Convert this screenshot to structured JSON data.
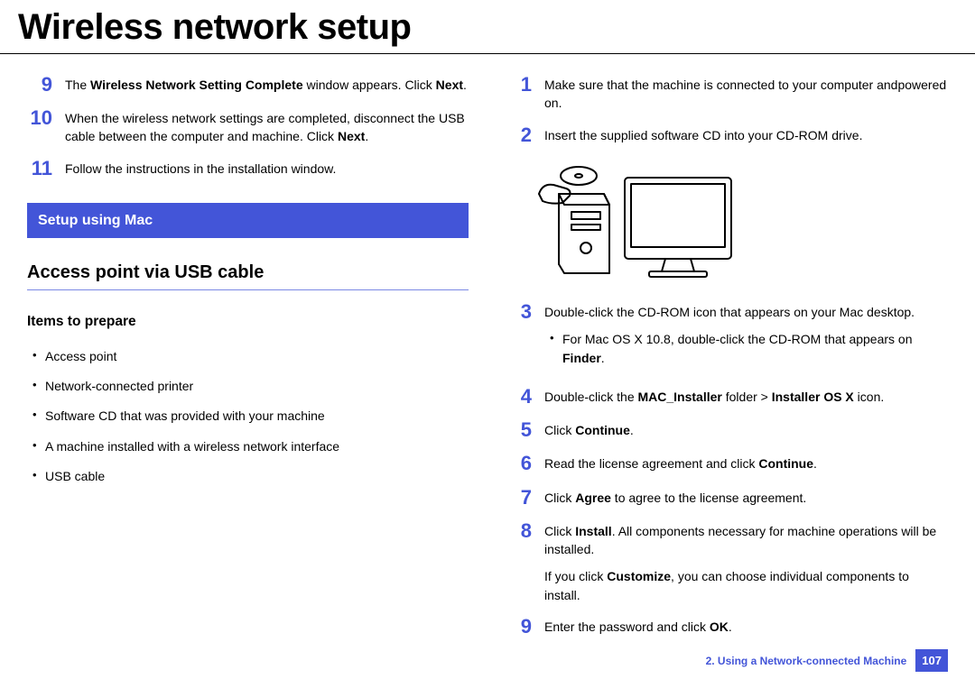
{
  "title": "Wireless network setup",
  "left": {
    "steps": [
      {
        "n": "9",
        "html": "The <b>Wireless Network Setting Complete</b> window appears. Click <b>Next</b>."
      },
      {
        "n": "10",
        "html": "When the wireless network settings are completed, disconnect the USB cable between the computer and machine. Click <b>Next</b>."
      },
      {
        "n": "11",
        "html": "Follow the instructions in the installation window."
      }
    ],
    "banner": "Setup using Mac",
    "h2": "Access point via USB cable",
    "h3": "Items to prepare",
    "items": [
      "Access point",
      "Network-connected printer",
      "Software CD that was provided with your machine",
      "A machine installed with a wireless network interface",
      "USB cable"
    ]
  },
  "right": {
    "steps_a": [
      {
        "n": "1",
        "html": "Make sure that the machine is connected to your computer andpowered on."
      },
      {
        "n": "2",
        "html": "Insert the supplied software CD into your CD-ROM drive."
      }
    ],
    "steps_b": [
      {
        "n": "3",
        "html": "Double-click the CD-ROM icon that appears on your Mac desktop.",
        "sub": [
          "For Mac OS X 10.8, double-click the CD-ROM that appears on <b>Finder</b>."
        ]
      },
      {
        "n": "4",
        "html": "Double-click the <b>MAC_Installer</b> folder &gt; <b>Installer OS X</b> icon."
      },
      {
        "n": "5",
        "html": "Click <b>Continue</b>."
      },
      {
        "n": "6",
        "html": "Read the license agreement and click <b>Continue</b>."
      },
      {
        "n": "7",
        "html": "Click <b>Agree</b> to agree to the license agreement."
      },
      {
        "n": "8",
        "html": "Click <b>Install</b>. All components necessary for machine operations will be installed.",
        "after": "If you click <b>Customize</b>, you can choose individual components to install."
      },
      {
        "n": "9",
        "html": "Enter the password and click <b>OK</b>."
      }
    ]
  },
  "footer": {
    "chapter": "2.  Using a Network-connected Machine",
    "page": "107"
  }
}
